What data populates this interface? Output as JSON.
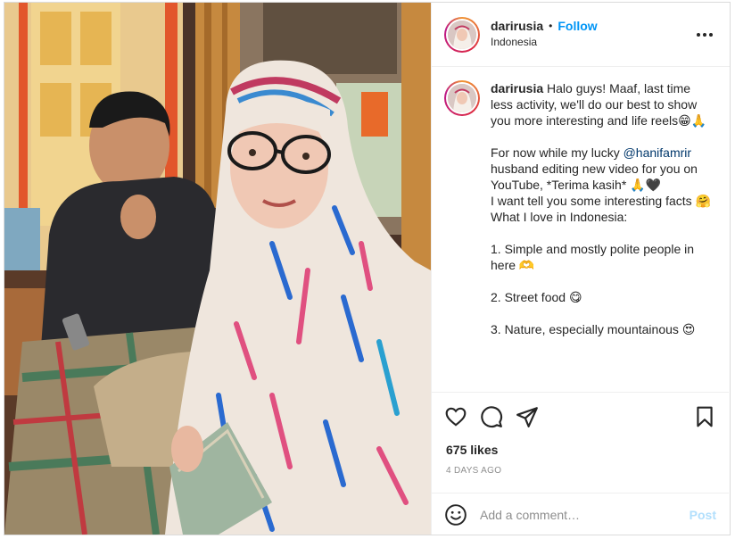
{
  "post": {
    "username": "darirusia",
    "separator": "•",
    "follow_label": "Follow",
    "location": "Indonesia",
    "more_icon": "more-horizontal-icon"
  },
  "caption": {
    "username": "darirusia",
    "line1": " Halo guys! Maaf, last time less activity, we'll do our best to show you more interesting and life reels😁🙏\n\nFor now while my lucky ",
    "mention": "@hanifamrir",
    "line2": " husband editing new video for you on YouTube, *Terima kasih* 🙏🖤\nI want tell you some interesting facts 🤗\nWhat I love in Indonesia:\n\n1. Simple and mostly polite people in here 🫶\n\n2. Street food 😋\n\n3. Nature, especially mountainous 😍"
  },
  "actions": {
    "like_icon": "heart-icon",
    "comment_icon": "comment-icon",
    "share_icon": "share-icon",
    "save_icon": "bookmark-icon",
    "likes": "675 likes",
    "time": "4 DAYS AGO"
  },
  "comment": {
    "emoji_icon": "smiley-icon",
    "placeholder": "Add a comment…",
    "post_label": "Post"
  },
  "colors": {
    "accent": "#0095f6",
    "post_disabled": "#b2dffc",
    "muted": "#8e8e8e"
  }
}
